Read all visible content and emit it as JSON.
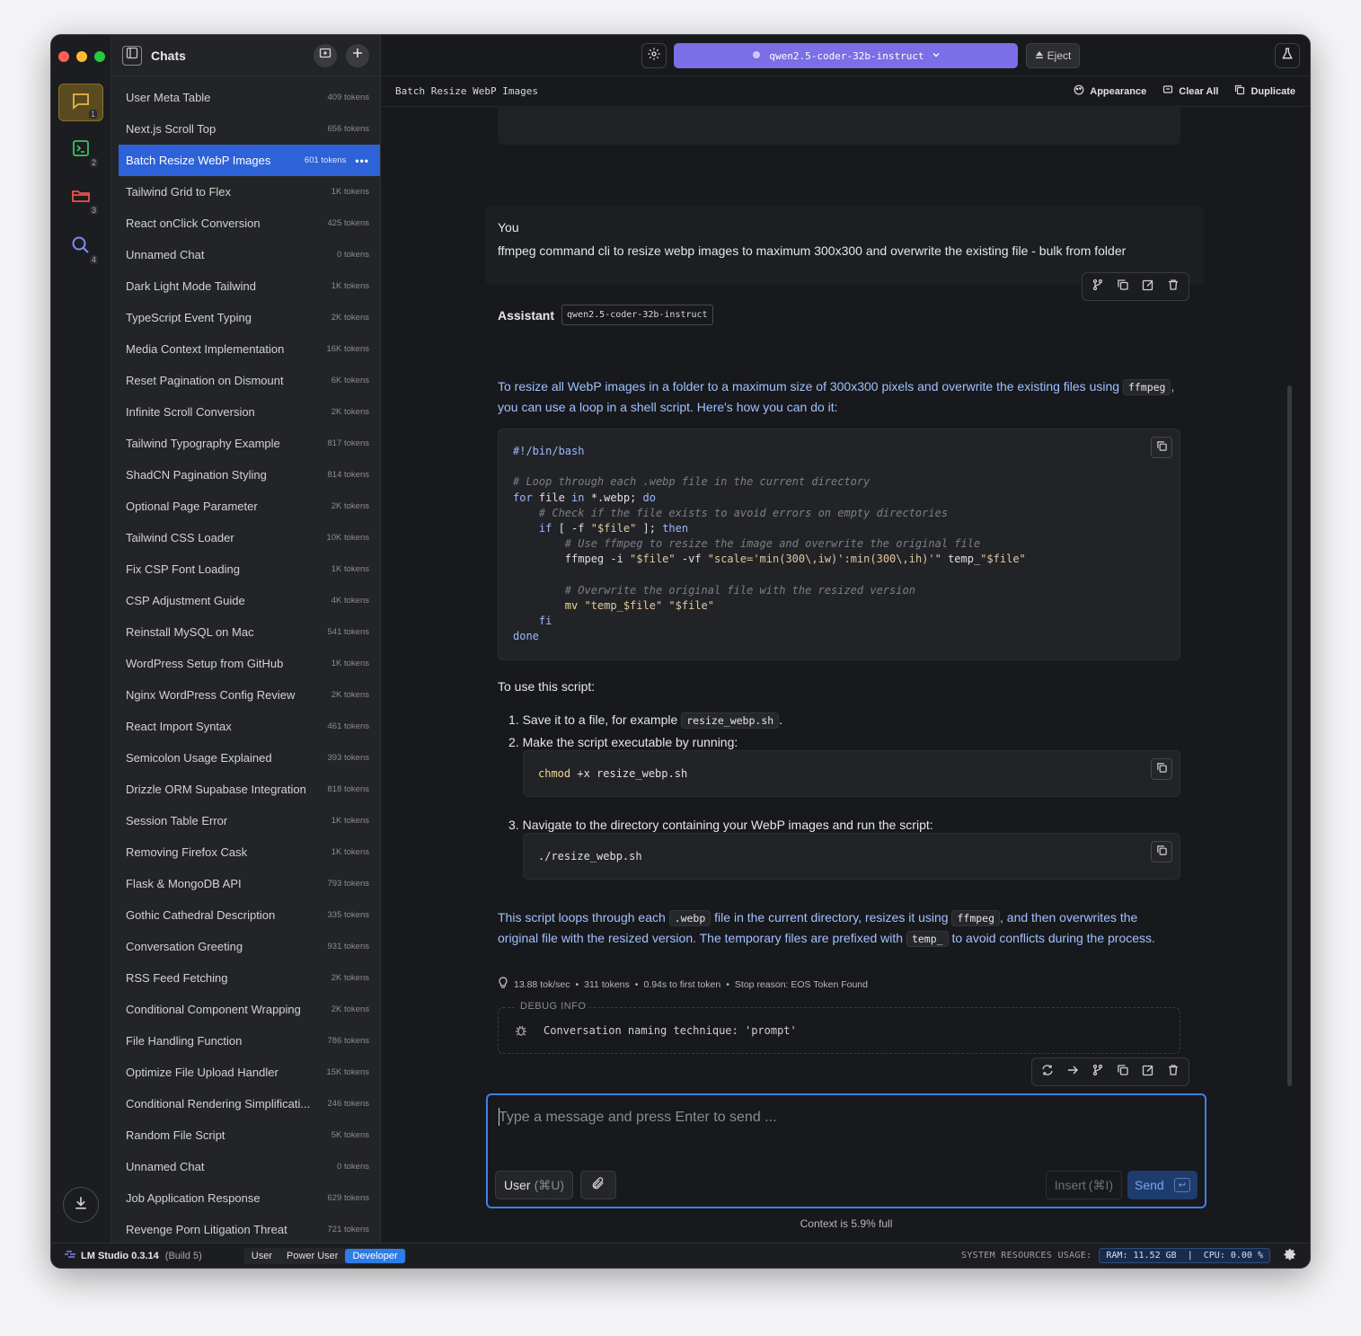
{
  "window": {
    "traffic_lights": {
      "close": "#ff5f57",
      "minimize": "#febc2e",
      "maximize": "#28c840"
    }
  },
  "rail": {
    "items": [
      {
        "icon": "chat-icon",
        "num": "1"
      },
      {
        "icon": "terminal-icon",
        "num": "2"
      },
      {
        "icon": "folder-icon",
        "num": "3"
      },
      {
        "icon": "search-icon",
        "num": "4"
      }
    ]
  },
  "sidebar": {
    "title": "Chats",
    "chats": [
      {
        "name": "User Meta Table",
        "tokens": "409 tokens"
      },
      {
        "name": "Next.js Scroll Top",
        "tokens": "656 tokens"
      },
      {
        "name": "Batch Resize WebP Images",
        "tokens": "601 tokens",
        "selected": true
      },
      {
        "name": "Tailwind Grid to Flex",
        "tokens": "1K tokens"
      },
      {
        "name": "React onClick Conversion",
        "tokens": "425 tokens"
      },
      {
        "name": "Unnamed Chat",
        "tokens": "0 tokens"
      },
      {
        "name": "Dark Light Mode Tailwind",
        "tokens": "1K tokens"
      },
      {
        "name": "TypeScript Event Typing",
        "tokens": "2K tokens"
      },
      {
        "name": "Media Context Implementation",
        "tokens": "16K tokens"
      },
      {
        "name": "Reset Pagination on Dismount",
        "tokens": "6K tokens"
      },
      {
        "name": "Infinite Scroll Conversion",
        "tokens": "2K tokens"
      },
      {
        "name": "Tailwind Typography Example",
        "tokens": "817 tokens"
      },
      {
        "name": "ShadCN Pagination Styling",
        "tokens": "814 tokens"
      },
      {
        "name": "Optional Page Parameter",
        "tokens": "2K tokens"
      },
      {
        "name": "Tailwind CSS Loader",
        "tokens": "10K tokens"
      },
      {
        "name": "Fix CSP Font Loading",
        "tokens": "1K tokens"
      },
      {
        "name": "CSP Adjustment Guide",
        "tokens": "4K tokens"
      },
      {
        "name": "Reinstall MySQL on Mac",
        "tokens": "541 tokens"
      },
      {
        "name": "WordPress Setup from GitHub",
        "tokens": "1K tokens"
      },
      {
        "name": "Nginx WordPress Config Review",
        "tokens": "2K tokens"
      },
      {
        "name": "React Import Syntax",
        "tokens": "461 tokens"
      },
      {
        "name": "Semicolon Usage Explained",
        "tokens": "393 tokens"
      },
      {
        "name": "Drizzle ORM Supabase Integration",
        "tokens": "818 tokens"
      },
      {
        "name": "Session Table Error",
        "tokens": "1K tokens"
      },
      {
        "name": "Removing Firefox Cask",
        "tokens": "1K tokens"
      },
      {
        "name": "Flask & MongoDB API",
        "tokens": "793 tokens"
      },
      {
        "name": "Gothic Cathedral Description",
        "tokens": "335 tokens"
      },
      {
        "name": "Conversation Greeting",
        "tokens": "931 tokens"
      },
      {
        "name": "RSS Feed Fetching",
        "tokens": "2K tokens"
      },
      {
        "name": "Conditional Component Wrapping",
        "tokens": "2K tokens"
      },
      {
        "name": "File Handling Function",
        "tokens": "786 tokens"
      },
      {
        "name": "Optimize File Upload Handler",
        "tokens": "15K tokens"
      },
      {
        "name": "Conditional Rendering Simplificati...",
        "tokens": "246 tokens"
      },
      {
        "name": "Random File Script",
        "tokens": "5K tokens"
      },
      {
        "name": "Unnamed Chat",
        "tokens": "0 tokens"
      },
      {
        "name": "Job Application Response",
        "tokens": "629 tokens"
      },
      {
        "name": "Revenge Porn Litigation Threat",
        "tokens": "721 tokens"
      }
    ]
  },
  "topbar": {
    "model": "qwen2.5-coder-32b-instruct",
    "eject": "Eject"
  },
  "subbar": {
    "chat_title": "Batch Resize WebP Images",
    "appearance": "Appearance",
    "clear_all": "Clear All",
    "duplicate": "Duplicate"
  },
  "conversation": {
    "user": {
      "role": "You",
      "text": "ffmpeg command cli to resize webp images to maximum 300x300 and overwrite the existing file - bulk from folder"
    },
    "assistant": {
      "role": "Assistant",
      "model_tag": "qwen2.5-coder-32b-instruct",
      "intro_1": "To resize all WebP images in a folder to a maximum size of 300x300 pixels and overwrite the existing files using",
      "intro_code": "ffmpeg",
      "intro_2": ", you can use a loop in a shell script. Here's how you can do it:",
      "use_title": "To use this script:",
      "step1_num": "1.",
      "step1_a": "Save it to a file, for example",
      "step1_code": "resize_webp.sh",
      "step1_b": ".",
      "step2_num": "2.",
      "step2": "Make the script executable by running:",
      "step2_code_kw": "chmod",
      "step2_code_rest": " +x resize_webp.sh",
      "step3_num": "3.",
      "step3": "Navigate to the directory containing your WebP images and run the script:",
      "step3_code": "./resize_webp.sh",
      "outro_1": "This script loops through each",
      "outro_code1": ".webp",
      "outro_2": "file in the current directory, resizes it using",
      "outro_code2": "ffmpeg",
      "outro_3": ", and then overwrites the original file with the resized version. The temporary files are prefixed with",
      "outro_code3": "temp_",
      "outro_4": "to avoid conflicts during the process.",
      "stats": {
        "speed": "13.88 tok/sec",
        "tokens": "311 tokens",
        "first_token": "0.94s to first token",
        "stop": "Stop reason: EOS Token Found",
        "sep": "•"
      },
      "debug_label": "DEBUG INFO",
      "debug_text": "Conversation naming technique: 'prompt'"
    }
  },
  "composer": {
    "placeholder": "Type a message and press Enter to send ...",
    "role": "User",
    "role_shortcut": "(⌘U)",
    "insert": "Insert",
    "insert_shortcut": "(⌘I)",
    "send": "Send",
    "enter_glyph": "↩"
  },
  "context": "Context is 5.9% full",
  "statusbar": {
    "app": "LM Studio 0.3.14",
    "build": "(Build 5)",
    "modes": [
      "User",
      "Power User",
      "Developer"
    ],
    "active_mode": "Developer",
    "resources_label": "SYSTEM RESOURCES USAGE:",
    "resources_value": "RAM: 11.52 GB  |  CPU: 0.00 %"
  }
}
